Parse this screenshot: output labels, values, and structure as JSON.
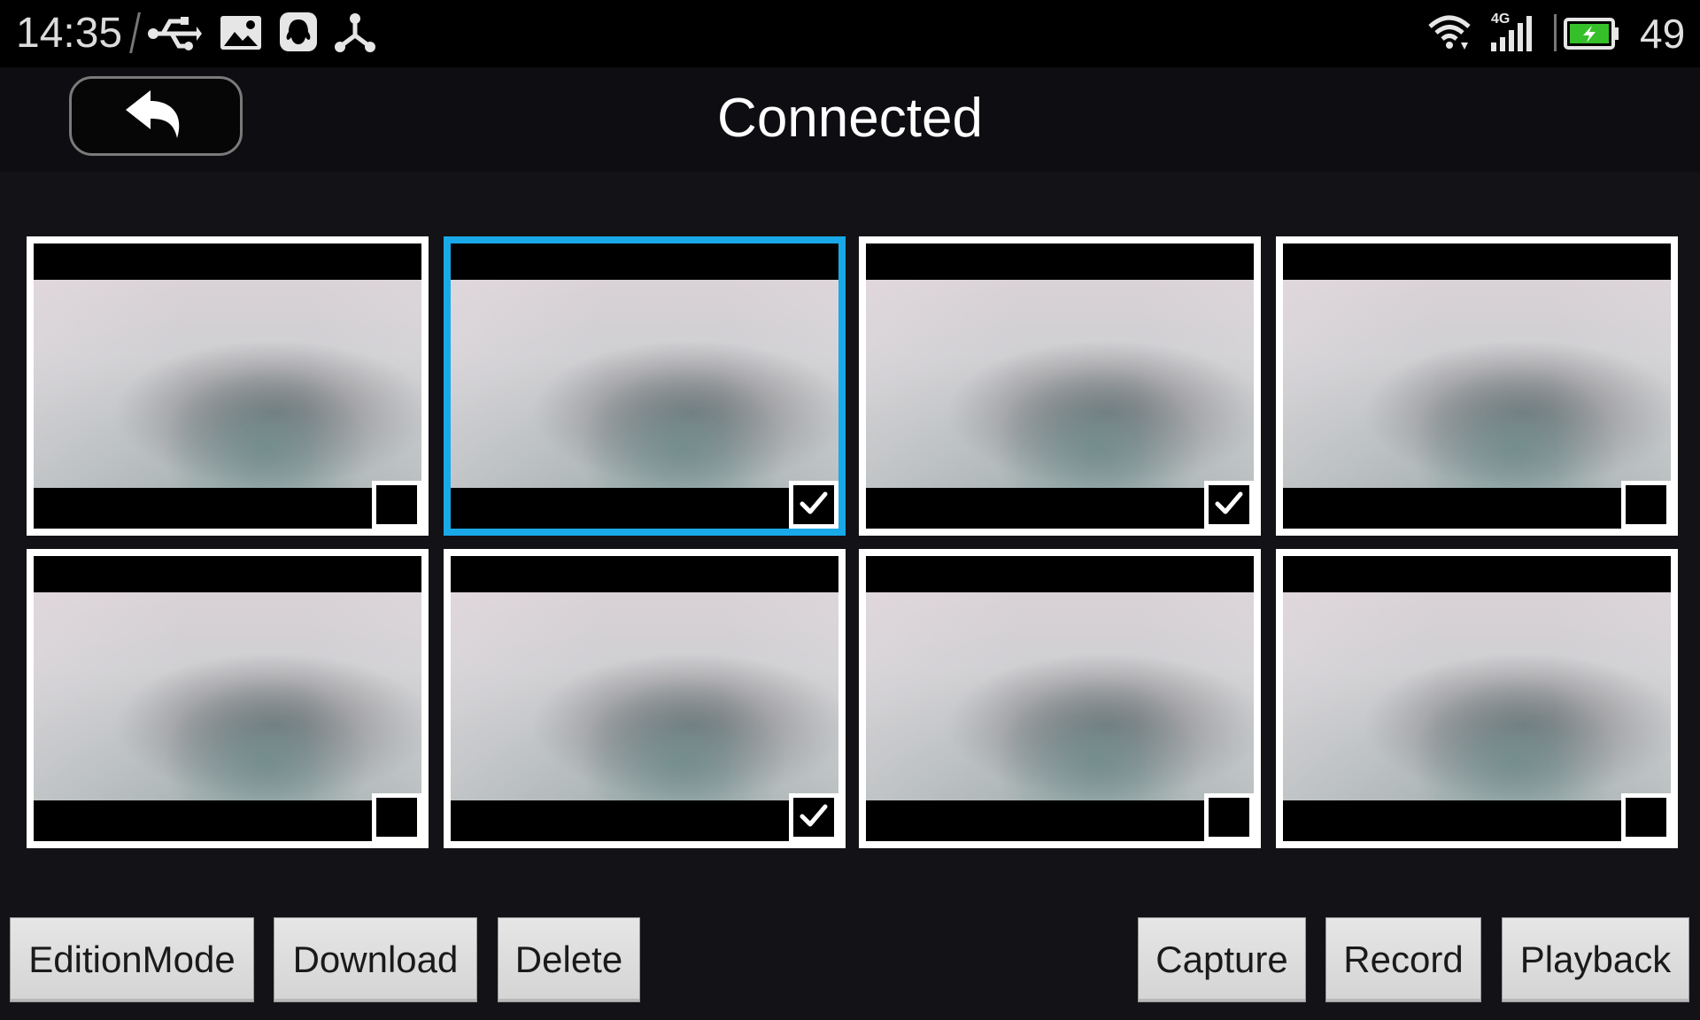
{
  "status_bar": {
    "time": "14:35",
    "battery_level": "49",
    "network_type": "4G",
    "icons": [
      "usb-icon",
      "gallery-icon",
      "qq-icon",
      "share-icon",
      "wifi-icon",
      "signal-icon",
      "battery-charging-icon"
    ]
  },
  "header": {
    "title": "Connected",
    "back_icon": "back-arrow-icon"
  },
  "thumbnails": [
    {
      "selected": false,
      "checked": false
    },
    {
      "selected": true,
      "checked": true
    },
    {
      "selected": false,
      "checked": true
    },
    {
      "selected": false,
      "checked": false
    },
    {
      "selected": false,
      "checked": false
    },
    {
      "selected": false,
      "checked": true
    },
    {
      "selected": false,
      "checked": false
    },
    {
      "selected": false,
      "checked": false
    }
  ],
  "buttons": {
    "edition_mode": "EditionMode",
    "download": "Download",
    "delete": "Delete",
    "capture": "Capture",
    "record": "Record",
    "playback": "Playback"
  },
  "colors": {
    "selection_accent": "#1aa9e8",
    "background": "#131217",
    "battery_green": "#35c02a"
  }
}
